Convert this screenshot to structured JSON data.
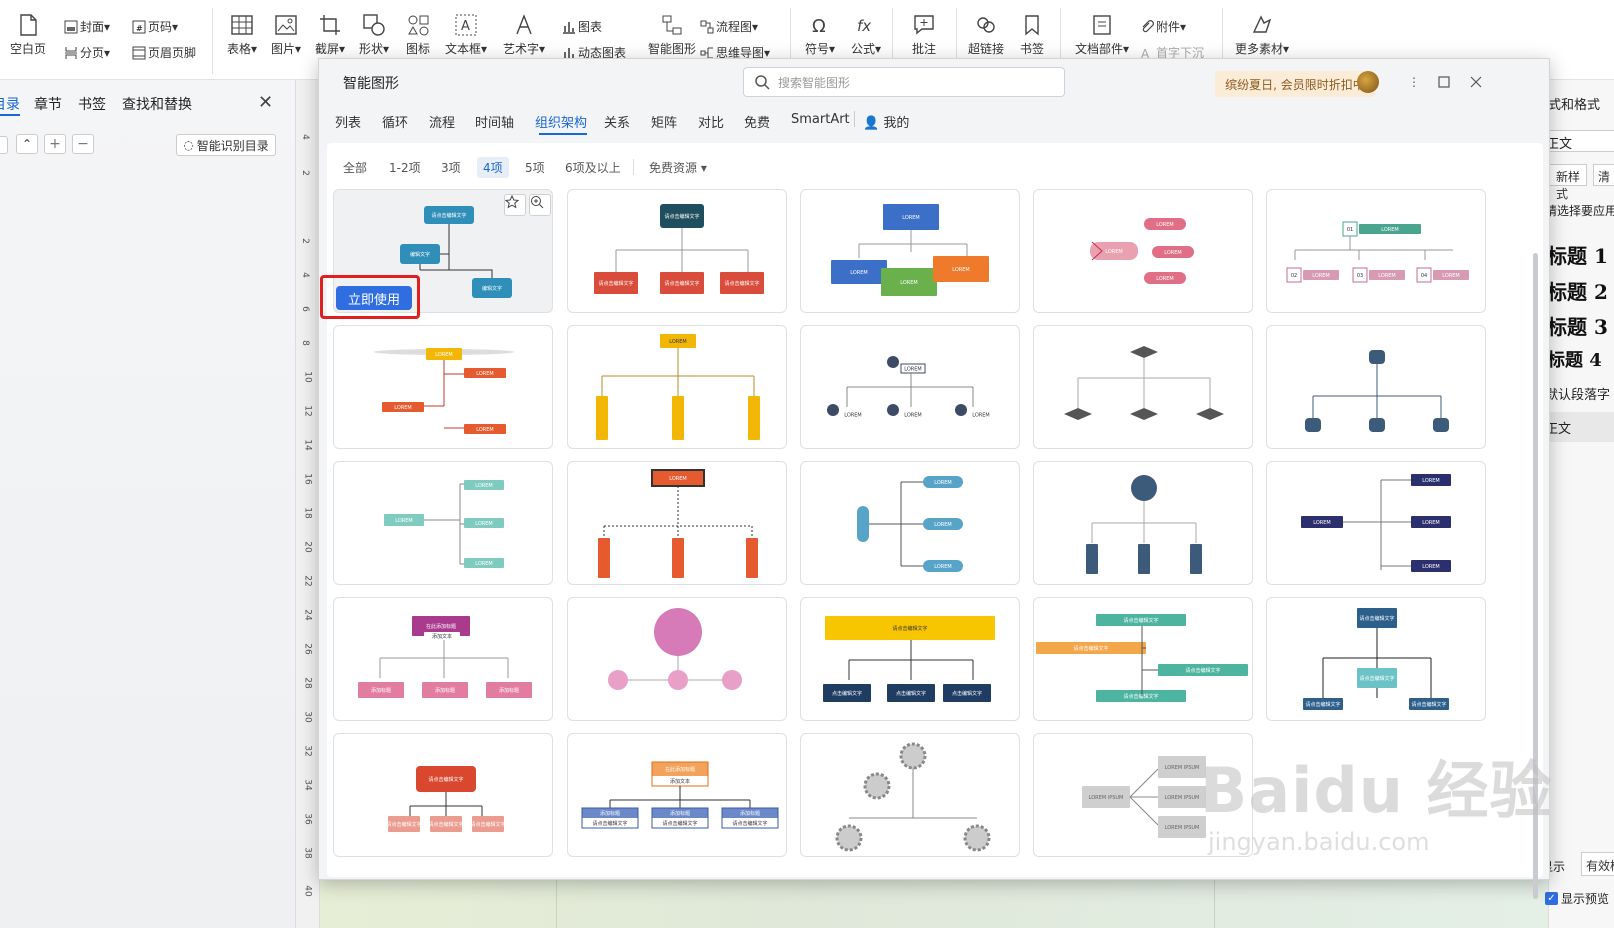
{
  "ribbon": {
    "blank_page": "空白页",
    "cover": "封面",
    "page_break": "分页",
    "page_num": "页码",
    "header_footer": "页眉页脚",
    "table": "表格",
    "image": "图片",
    "screenshot": "截屏",
    "shape": "形状",
    "icon": "图标",
    "textbox": "文本框",
    "wordart": "艺术字",
    "chart": "图表",
    "dynamic_chart": "动态图表",
    "smart_art": "智能图形",
    "flowchart": "流程图",
    "mindmap": "思维导图",
    "symbol": "符号",
    "formula": "公式",
    "comment": "批注",
    "hyperlink": "超链接",
    "bookmark": "书签",
    "doc_part": "文档部件",
    "drop_cap": "首字下沉",
    "attachment": "附件",
    "more_material": "更多素材"
  },
  "leftnav": {
    "tabs": [
      "目录",
      "章节",
      "书签",
      "查找和替换"
    ],
    "smart_toc": "智能识别目录"
  },
  "ruler": [
    "4",
    "2",
    "2",
    "4",
    "6",
    "8",
    "10",
    "12",
    "14",
    "16",
    "18",
    "20",
    "22",
    "24",
    "26",
    "28",
    "30",
    "32",
    "34",
    "36",
    "38",
    "40"
  ],
  "rightpanel": {
    "title": "样式和格式",
    "current": "正文",
    "new_style": "新样式",
    "clear": "清",
    "hint": "请选择要应用的",
    "headings": [
      "标题 1",
      "标题 2",
      "标题 3",
      "标题 4"
    ],
    "default_font": "默认段落字",
    "body": "正文",
    "show": "显示",
    "valid_styles": "有效样",
    "preview": "显示预览"
  },
  "dialog": {
    "title": "智能图形",
    "search_placeholder": "搜索智能图形",
    "promo": "缤纷夏日, 会员限时折扣中",
    "categories": [
      "列表",
      "循环",
      "流程",
      "时间轴",
      "组织架构",
      "关系",
      "矩阵",
      "对比",
      "免费",
      "SmartArt",
      "我的"
    ],
    "active_category": "组织架构",
    "filters": [
      "全部",
      "1-2项",
      "3项",
      "4项",
      "5项",
      "6项及以上",
      "免费资源"
    ],
    "active_filter": "4项",
    "use_now": "立即使用"
  },
  "colors": {
    "accent": "#1a66d6",
    "use_button": "#2f6de0",
    "highlight": "#e0201e",
    "promo_bg": "#fbecd8"
  },
  "watermark": {
    "brand": "Baidu 经验",
    "url": "jingyan.baidu.com"
  },
  "templates": {
    "placeholder": "LOREM",
    "placeholder_ipsum": "LOREM IPSUM",
    "edit_text": "请点击编辑文字",
    "edit_text_short": "编辑文字",
    "edit_here": "在此添加标题",
    "add_text": "添加文本",
    "add_title": "添加标题",
    "click_edit": "点击编辑文字"
  }
}
